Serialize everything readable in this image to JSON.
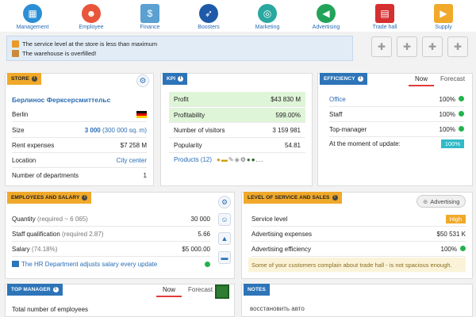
{
  "nav": [
    {
      "label": "Management",
      "icon": "management-icon",
      "color": "#2b8fd6"
    },
    {
      "label": "Employee",
      "icon": "employee-icon",
      "color": "#e8553a"
    },
    {
      "label": "Finance",
      "icon": "finance-icon",
      "color": "#5aa0d0"
    },
    {
      "label": "Boosters",
      "icon": "boosters-icon",
      "color": "#1f5aa8"
    },
    {
      "label": "Marketing",
      "icon": "marketing-icon",
      "color": "#2aa8a0"
    },
    {
      "label": "Advertising",
      "icon": "advertising-icon",
      "color": "#22a35a"
    },
    {
      "label": "Trade hall",
      "icon": "trade-hall-icon",
      "color": "#d62f2f"
    },
    {
      "label": "Supply",
      "icon": "supply-icon",
      "color": "#f0a92a"
    }
  ],
  "alerts": [
    {
      "text": "The service level at the store is less than maximum"
    },
    {
      "text": "The warehouse is overfilled!"
    }
  ],
  "store": {
    "tag": "Store",
    "name": "Берлинос Ферксерсмиттельс",
    "city": "Berlin",
    "size_label": "Size",
    "size_value": "3 000",
    "size_extra": "(300 000 sq. m)",
    "rent_label": "Rent expenses",
    "rent_value": "$7 258 M",
    "location_label": "Location",
    "location_value": "City center",
    "departments_label": "Number of departments",
    "departments_value": "1"
  },
  "kpi": {
    "tag": "KPI",
    "profit_label": "Profit",
    "profit_value": "$43 830 M",
    "profitability_label": "Profitability",
    "profitability_value": "599.00%",
    "visitors_label": "Number of visitors",
    "visitors_value": "3 159 981",
    "popularity_label": "Popularity",
    "popularity_value": "54.81",
    "products_label": "Products (12)",
    "products_more": "..."
  },
  "efficiency": {
    "tag": "Efficiency",
    "tab_now": "Now",
    "tab_forecast": "Forecast",
    "office_label": "Office",
    "office_value": "100%",
    "staff_label": "Staff",
    "staff_value": "100%",
    "topmanager_label": "Top-manager",
    "topmanager_value": "100%",
    "update_label": "At the moment of update:",
    "update_value": "100%"
  },
  "employees": {
    "tag": "Employees and salary",
    "quantity_label": "Quantity",
    "quantity_hint": "(required ~ 6 065)",
    "quantity_value": "30 000",
    "qualification_label": "Staff qualification",
    "qualification_hint": "(required 2.87)",
    "qualification_value": "5.66",
    "salary_label": "Salary",
    "salary_hint": "(74.18%)",
    "salary_value": "$5 000.00",
    "hr_text": "The HR Department adjusts salary every update"
  },
  "service": {
    "tag": "Level of service and sales",
    "advertising_btn": "Advertising",
    "level_label": "Service level",
    "level_value": "High",
    "adexp_label": "Advertising expenses",
    "adexp_value": "$50 531 K",
    "adeff_label": "Advertising efficiency",
    "adeff_value": "100%",
    "warning": "Some of your customers complain about trade hall - is not spacious enough."
  },
  "top_manager": {
    "tag": "Top manager",
    "tab_now": "Now",
    "tab_forecast": "Forecast",
    "employees_label": "Total number of employees"
  },
  "notes": {
    "tag": "Notes",
    "text": "восстановить авто"
  }
}
